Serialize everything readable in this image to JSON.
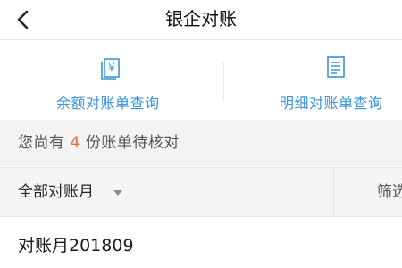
{
  "header": {
    "title": "银企对账",
    "back_icon": "chevron-left-icon"
  },
  "actions": [
    {
      "label": "余额对账单查询",
      "icon": "yen-document-icon"
    },
    {
      "label": "明细对账单查询",
      "icon": "list-document-icon"
    }
  ],
  "notice": {
    "prefix": "您尚有",
    "count": "4",
    "suffix": "份账单待核对"
  },
  "filter_bar": {
    "period_label": "全部对账月",
    "filter_label": "筛选"
  },
  "list": {
    "items": [
      {
        "title": "对账月201809"
      }
    ]
  },
  "colors": {
    "accent": "#3a94d8",
    "highlight": "#e8643a",
    "band": "#f3f3f3"
  }
}
